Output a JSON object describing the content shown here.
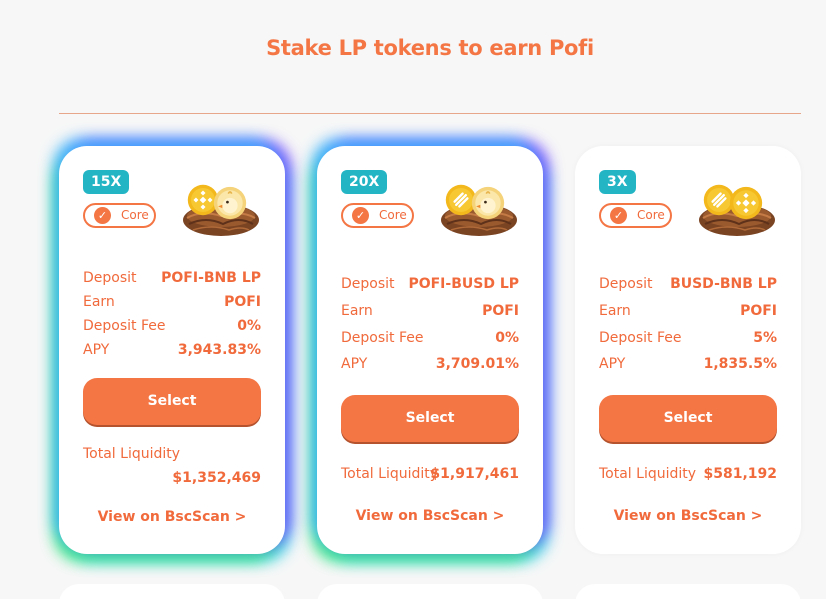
{
  "title": "Stake LP tokens to earn Pofi",
  "colors": {
    "accent": "#f47645",
    "multiplier_bg": "#24b5c5",
    "card_bg": "#ffffff"
  },
  "cards": [
    {
      "multiplier": "15X",
      "tag": "Core",
      "logo_icons": [
        "bnb-coin-icon",
        "pofi-chick-coin-icon",
        "nest-icon"
      ],
      "rows": [
        {
          "label": "Deposit",
          "value": "POFI-BNB LP"
        },
        {
          "label": "Earn",
          "value": "POFI"
        },
        {
          "label": "Deposit Fee",
          "value": "0%"
        },
        {
          "label": "APY",
          "value": "3,943.83%"
        }
      ],
      "select_label": "Select",
      "total_liquidity_label": "Total Liquidity",
      "total_liquidity_value": "$1,352,469",
      "bscscan_label": "View on BscScan >"
    },
    {
      "multiplier": "20X",
      "tag": "Core",
      "logo_icons": [
        "busd-coin-icon",
        "pofi-chick-coin-icon",
        "nest-icon"
      ],
      "rows": [
        {
          "label": "Deposit",
          "value": "POFI-BUSD LP"
        },
        {
          "label": "Earn",
          "value": "POFI"
        },
        {
          "label": "Deposit Fee",
          "value": "0%"
        },
        {
          "label": "APY",
          "value": "3,709.01%"
        }
      ],
      "select_label": "Select",
      "total_liquidity_label": "Total Liquidity",
      "total_liquidity_value": "$1,917,461",
      "bscscan_label": "View on BscScan >"
    },
    {
      "multiplier": "3X",
      "tag": "Core",
      "logo_icons": [
        "busd-coin-icon",
        "bnb-coin-icon",
        "nest-icon"
      ],
      "rows": [
        {
          "label": "Deposit",
          "value": "BUSD-BNB LP"
        },
        {
          "label": "Earn",
          "value": "POFI"
        },
        {
          "label": "Deposit Fee",
          "value": "5%"
        },
        {
          "label": "APY",
          "value": "1,835.5%"
        }
      ],
      "select_label": "Select",
      "total_liquidity_label": "Total Liquidity",
      "total_liquidity_value": "$581,192",
      "bscscan_label": "View on BscScan >"
    }
  ]
}
